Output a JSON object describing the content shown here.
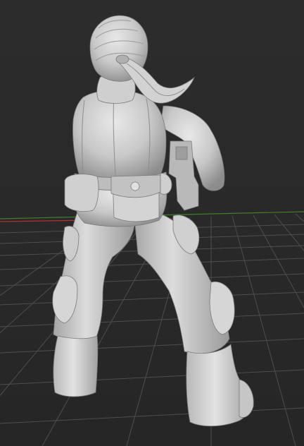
{
  "viewport": {
    "background_color": "#2b2b2b",
    "grid_color": "#555555",
    "grid_major_color": "#5e5e5e",
    "axis_x_color": "#b23030",
    "axis_y_color": "#3f7f2a",
    "model_color": "#c9c9c9",
    "model_shadow_color": "#8a8a8a",
    "model_highlight_color": "#e6e6e6",
    "shading_mode": "solid-matcap",
    "subject": "sculpted-figure-back-view"
  }
}
